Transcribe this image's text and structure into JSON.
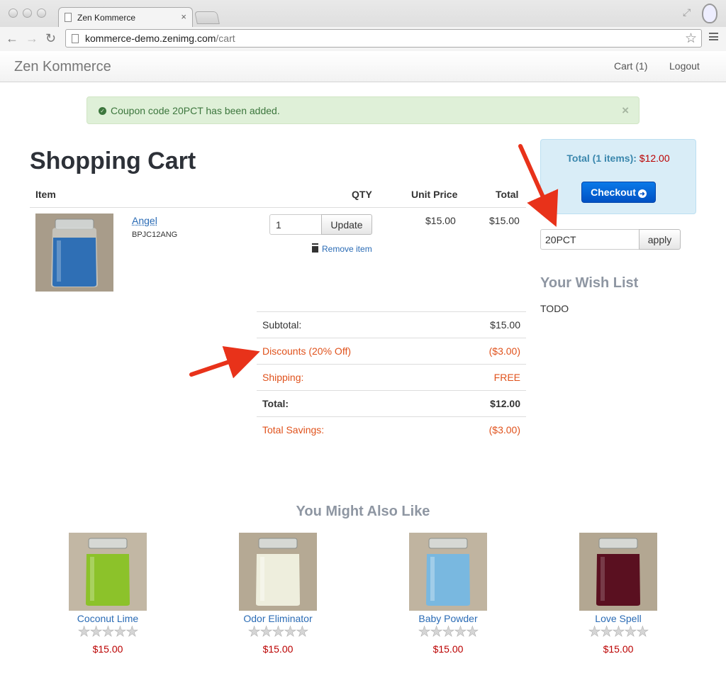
{
  "browser": {
    "tab_title": "Zen Kommerce",
    "tab_close": "×",
    "url_host": "kommerce-demo.zenimg.com",
    "url_path": "/cart",
    "back": "←",
    "forward": "→",
    "reload": "↻",
    "bookmark_star": "☆",
    "resize": "⤢"
  },
  "navbar": {
    "brand": "Zen Kommerce",
    "cart_link": "Cart (1)",
    "logout_link": "Logout"
  },
  "alert": {
    "message": "Coupon code 20PCT has been added.",
    "close": "×",
    "check": "✓"
  },
  "cart": {
    "title": "Shopping Cart",
    "headers": {
      "item": "Item",
      "qty": "QTY",
      "unit_price": "Unit Price",
      "total": "Total"
    },
    "items": [
      {
        "name": "Angel",
        "sku": "BPJC12ANG",
        "qty": "1",
        "update_label": "Update",
        "remove_label": "Remove item",
        "unit_price": "$15.00",
        "total": "$15.00",
        "jar_color": "#2f6fb5"
      }
    ],
    "summary": {
      "subtotal_label": "Subtotal:",
      "subtotal": "$15.00",
      "discount_label": "Discounts (20% Off)",
      "discount": "($3.00)",
      "shipping_label": "Shipping:",
      "shipping": "FREE",
      "total_label": "Total:",
      "total": "$12.00",
      "savings_label": "Total Savings:",
      "savings": "($3.00)"
    }
  },
  "sidebar": {
    "total_label": "Total (1 items):",
    "total_amount": "$12.00",
    "checkout_label": "Checkout",
    "coupon_value": "20PCT",
    "apply_label": "apply",
    "wishlist_title": "Your Wish List",
    "wishlist_body": "TODO"
  },
  "recommendations": {
    "title": "You Might Also Like",
    "stars": "★★★★★",
    "items": [
      {
        "name": "Coconut Lime",
        "price": "$15.00",
        "jar_color": "#8cc22a"
      },
      {
        "name": "Odor Eliminator",
        "price": "$15.00",
        "jar_color": "#eeeedd"
      },
      {
        "name": "Baby Powder",
        "price": "$15.00",
        "jar_color": "#79b8e0"
      },
      {
        "name": "Love Spell",
        "price": "$15.00",
        "jar_color": "#5a1020"
      }
    ]
  },
  "colors": {
    "accent_link": "#2a6bb5",
    "discount_orange": "#e0521c",
    "price_red": "#bb0000",
    "alert_green": "#3c763d",
    "annotation_arrow": "#e8321a"
  }
}
